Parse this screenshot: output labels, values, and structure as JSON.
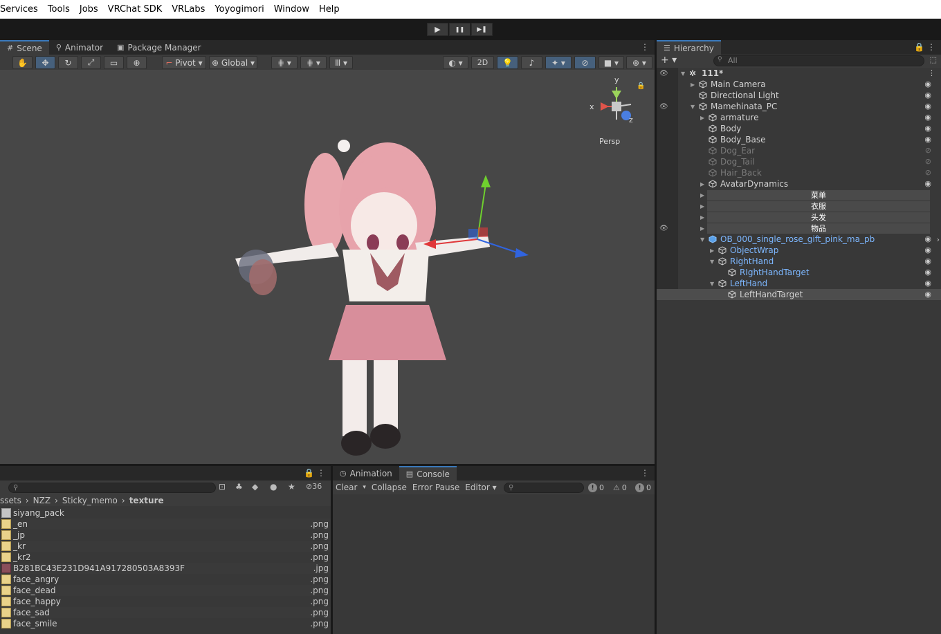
{
  "menubar": {
    "items": [
      "Services",
      "Tools",
      "Jobs",
      "VRChat SDK",
      "VRLabs",
      "Yoyogimori",
      "Window",
      "Help"
    ]
  },
  "playbar": {
    "play": "▶",
    "pause": "❚❚",
    "step": "▶❚"
  },
  "scene": {
    "tabs": [
      "Scene",
      "Animator",
      "Package Manager"
    ],
    "toolbar": {
      "pivot": "Pivot",
      "global": "Global",
      "twod": "2D"
    },
    "gizmo": {
      "y": "y",
      "x": "x",
      "z": "z",
      "persp": "Persp"
    }
  },
  "hierarchy": {
    "tab": "Hierarchy",
    "search_placeholder": "All",
    "scene_name": "111*",
    "rows": [
      {
        "label": "Main Camera"
      },
      {
        "label": "Directional Light"
      },
      {
        "label": "Mamehinata_PC"
      },
      {
        "label": "armature"
      },
      {
        "label": "Body"
      },
      {
        "label": "Body_Base"
      },
      {
        "label": "Dog_Ear"
      },
      {
        "label": "Dog_Tail"
      },
      {
        "label": "Hair_Back"
      },
      {
        "label": "AvatarDynamics"
      },
      {
        "label": "菜单"
      },
      {
        "label": "衣服"
      },
      {
        "label": "头发"
      },
      {
        "label": "物品"
      },
      {
        "label": "OB_000_single_rose_gift_pink_ma_pb"
      },
      {
        "label": "ObjectWrap"
      },
      {
        "label": "RightHand"
      },
      {
        "label": "RIghtHandTarget"
      },
      {
        "label": "LeftHand"
      },
      {
        "label": "LeftHandTarget"
      }
    ]
  },
  "project": {
    "hidden_count": "36",
    "breadcrumb": [
      "ssets",
      "NZZ",
      "Sticky_memo",
      "texture"
    ],
    "folder": "siyang_pack",
    "files": [
      {
        "name": "_en",
        "ext": ".png"
      },
      {
        "name": "_jp",
        "ext": ".png"
      },
      {
        "name": "_kr",
        "ext": ".png"
      },
      {
        "name": "_kr2",
        "ext": ".png"
      },
      {
        "name": "B281BC43E231D941A917280503A8393F",
        "ext": ".jpg"
      },
      {
        "name": "face_angry",
        "ext": ".png"
      },
      {
        "name": "face_dead",
        "ext": ".png"
      },
      {
        "name": "face_happy",
        "ext": ".png"
      },
      {
        "name": "face_sad",
        "ext": ".png"
      },
      {
        "name": "face_smile",
        "ext": ".png"
      }
    ]
  },
  "console": {
    "tabs": [
      "Animation",
      "Console"
    ],
    "clear": "Clear",
    "collapse": "Collapse",
    "error_pause": "Error Pause",
    "editor": "Editor",
    "log_count": "0",
    "warn_count": "0",
    "error_count": "0"
  }
}
